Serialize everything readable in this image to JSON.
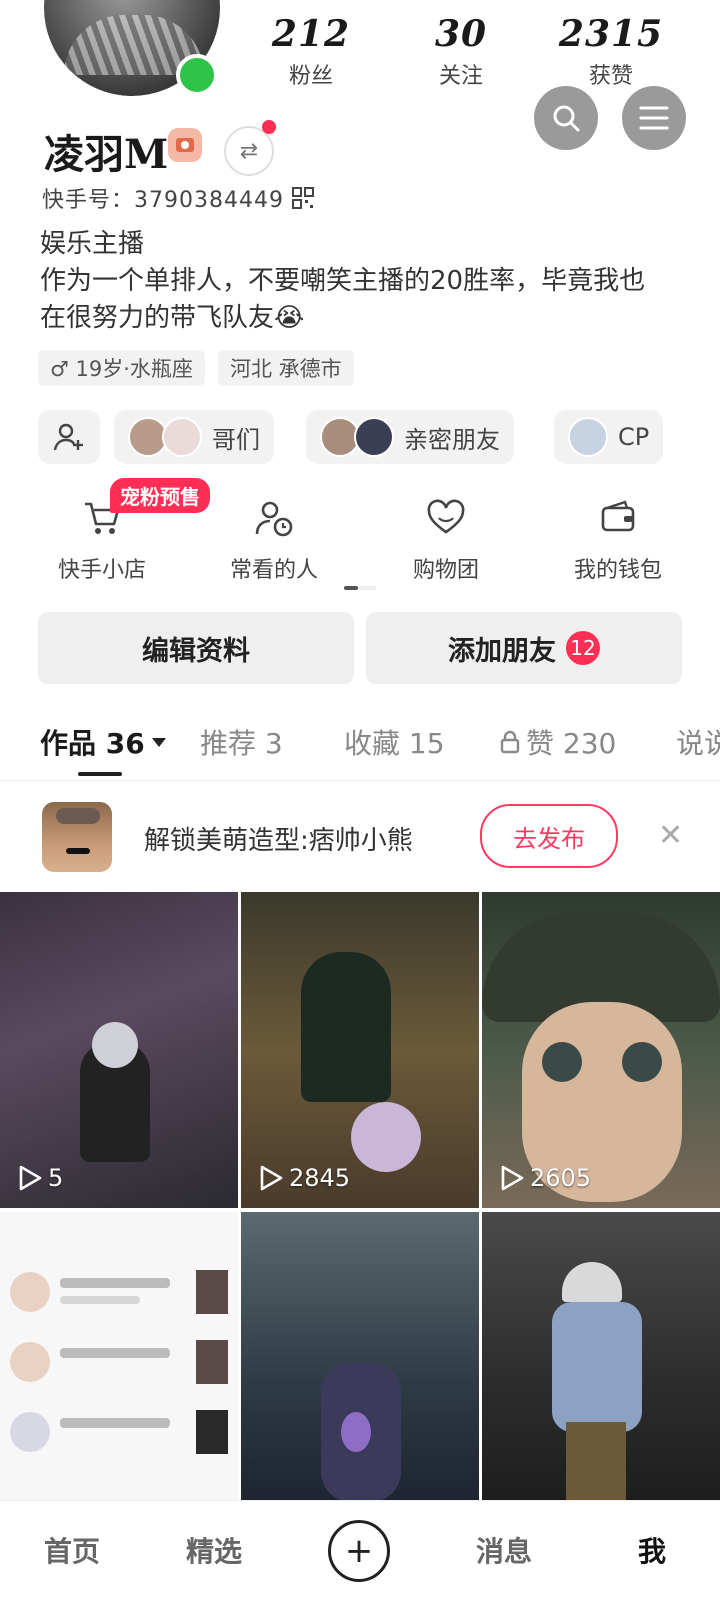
{
  "stats": [
    {
      "value": "212",
      "label": "粉丝"
    },
    {
      "value": "30",
      "label": "关注"
    },
    {
      "value": "2315",
      "label": "获赞"
    }
  ],
  "profile": {
    "name": "凌羽M",
    "kuaishou_id": "快手号：3790384449",
    "bio_line1": "娱乐主播",
    "bio_line2": "作为一个单排人，不要嘲笑主播的20胜率，毕竟我也",
    "bio_line3": "在很努力的带飞队友😭",
    "tags": [
      "♂ 19岁·水瓶座",
      "河北 承德市"
    ]
  },
  "friend_groups": [
    "哥们",
    "亲密朋友",
    "CP"
  ],
  "services": [
    {
      "label": "快手小店",
      "icon": "cart-icon"
    },
    {
      "label": "常看的人",
      "icon": "person-clock-icon"
    },
    {
      "label": "购物团",
      "icon": "heart-group-icon"
    },
    {
      "label": "我的钱包",
      "icon": "wallet-icon"
    }
  ],
  "presale_badge": "宠粉预售",
  "actions": {
    "edit_profile": "编辑资料",
    "add_friend": "添加朋友",
    "add_friend_count": "12"
  },
  "tabs": [
    {
      "label": "作品 36"
    },
    {
      "label": "推荐 3"
    },
    {
      "label": "收藏 15"
    },
    {
      "label": "赞 230"
    },
    {
      "label": "说说"
    }
  ],
  "promo": {
    "text": "解锁美萌造型:痞帅小熊",
    "button": "去发布"
  },
  "videos": [
    {
      "plays": "5"
    },
    {
      "plays": "2845"
    },
    {
      "plays": "2605"
    }
  ],
  "nav": {
    "home": "首页",
    "featured": "精选",
    "messages": "消息",
    "me": "我"
  },
  "colors": {
    "accent": "#ff2e55",
    "online": "#30c34a"
  }
}
